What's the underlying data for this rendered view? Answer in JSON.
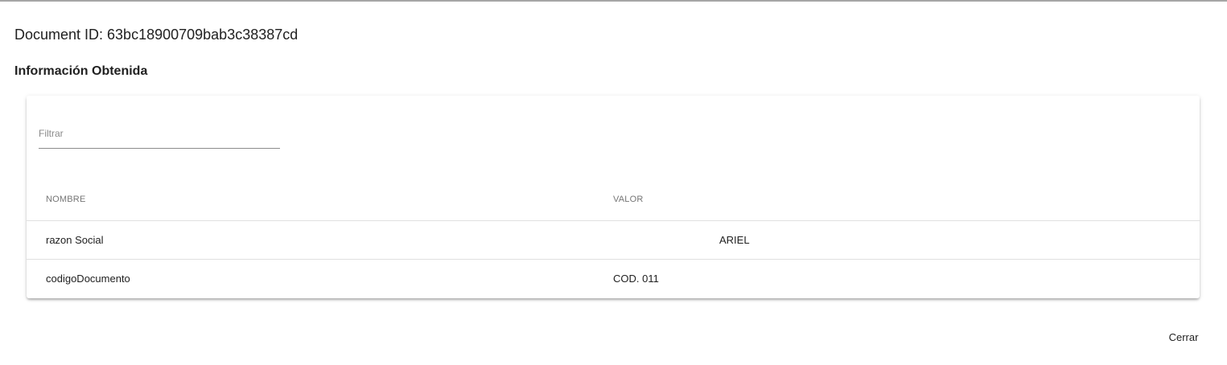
{
  "header": {
    "document_id": "Document ID: 63bc18900709bab3c38387cd",
    "section_title": "Información Obtenida"
  },
  "filter": {
    "placeholder": "Filtrar",
    "value": ""
  },
  "table": {
    "columns": [
      "NOMBRE",
      "VALOR"
    ],
    "rows": [
      {
        "nombre": "razon Social",
        "valor": "ARIEL"
      },
      {
        "nombre": "codigoDocumento",
        "valor": "COD. 011"
      }
    ]
  },
  "actions": {
    "close_label": "Cerrar"
  },
  "colors": {
    "divider": "#e0e0e0",
    "header_text": "#757575",
    "body_text": "#212121"
  }
}
